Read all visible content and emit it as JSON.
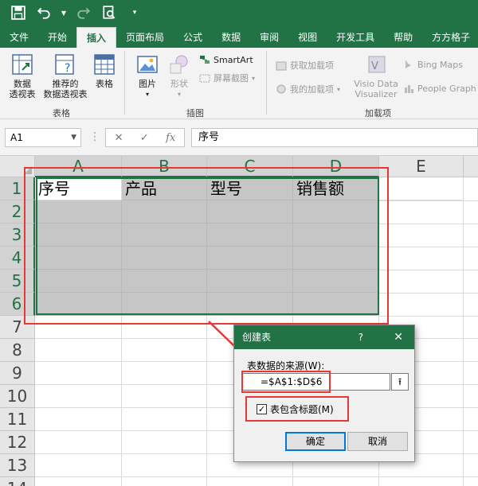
{
  "tabs": [
    "文件",
    "开始",
    "插入",
    "页面布局",
    "公式",
    "数据",
    "审阅",
    "视图",
    "开发工具",
    "帮助",
    "方方格子"
  ],
  "active_tab_index": 2,
  "ribbon": {
    "tables_group": {
      "pivot_line1": "数据",
      "pivot_line2": "透视表",
      "rec_pivot_line1": "推荐的",
      "rec_pivot_line2": "数据透视表",
      "table": "表格",
      "label": "表格"
    },
    "illustrations_group": {
      "pictures": "图片",
      "shapes": "形状",
      "smartart": "SmartArt",
      "screenshot": "屏幕截图",
      "label": "插图"
    },
    "addins_group": {
      "get_addins": "获取加载项",
      "my_addins": "我的加载项",
      "visio_line1": "Visio Data",
      "visio_line2": "Visualizer",
      "bing_maps": "Bing Maps",
      "people_graph": "People Graph",
      "label": "加载项"
    }
  },
  "formula_bar": {
    "name_box": "A1",
    "formula": "序号",
    "fx": "fx"
  },
  "sheet": {
    "columns": [
      "A",
      "B",
      "C",
      "D",
      "E"
    ],
    "rows": [
      "1",
      "2",
      "3",
      "4",
      "5",
      "6",
      "7",
      "8",
      "9",
      "10",
      "11",
      "12",
      "13",
      "14"
    ],
    "header_row": [
      "序号",
      "产品",
      "型号",
      "销售额"
    ]
  },
  "dialog": {
    "title": "创建表",
    "help": "?",
    "close": "✕",
    "source_label": "表数据的来源(W):",
    "range_value": "=$A$1:$D$6",
    "has_headers_label": "表包含标题(M)",
    "has_headers_checked": true,
    "ok": "确定",
    "cancel": "取消"
  },
  "colors": {
    "excel_green": "#217346",
    "highlight_red": "#e53935",
    "selection_shade": "#c6c6c6"
  }
}
